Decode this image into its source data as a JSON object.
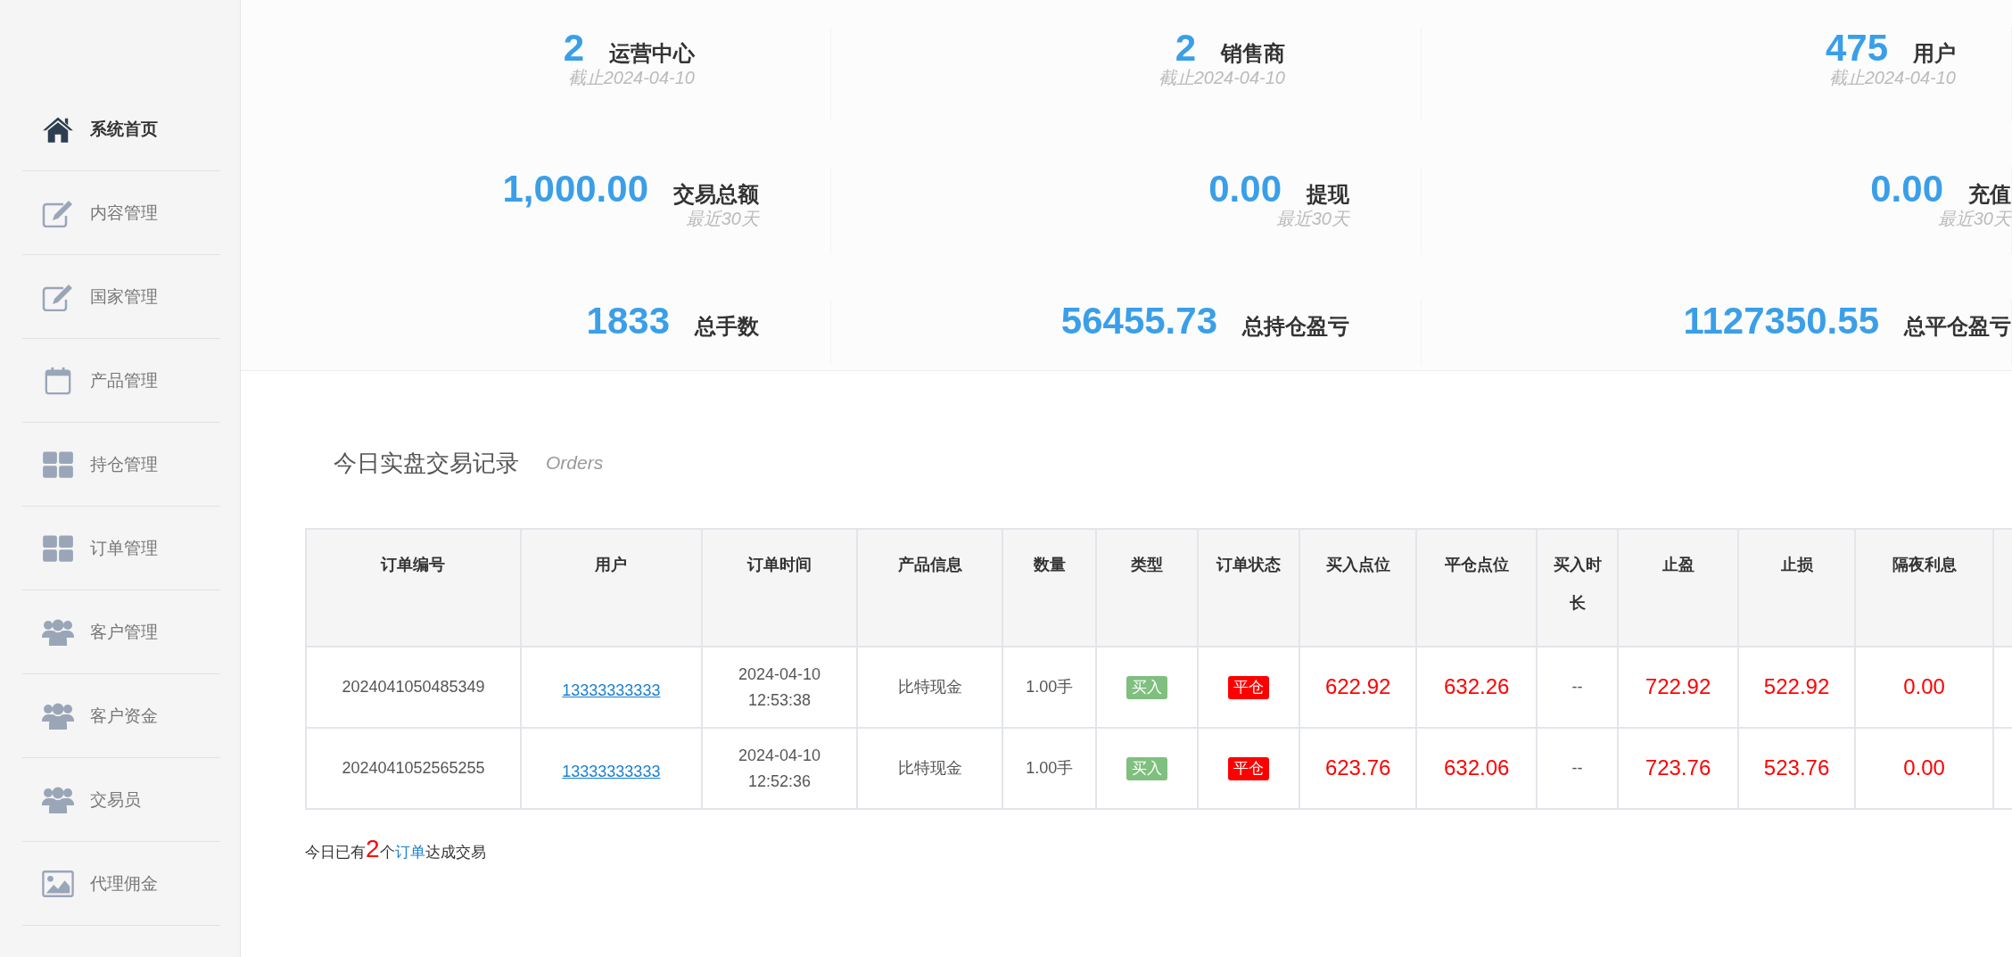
{
  "sidebar": {
    "items": [
      {
        "label": "系统首页",
        "kind": "home",
        "selected": true
      },
      {
        "label": "内容管理",
        "kind": "edit",
        "selected": false
      },
      {
        "label": "国家管理",
        "kind": "edit",
        "selected": false
      },
      {
        "label": "产品管理",
        "kind": "calendar",
        "selected": false
      },
      {
        "label": "持仓管理",
        "kind": "grid",
        "selected": false
      },
      {
        "label": "订单管理",
        "kind": "grid",
        "selected": false
      },
      {
        "label": "客户管理",
        "kind": "users",
        "selected": false
      },
      {
        "label": "客户资金",
        "kind": "users",
        "selected": false
      },
      {
        "label": "交易员",
        "kind": "users",
        "selected": false
      },
      {
        "label": "代理佣金",
        "kind": "image",
        "selected": false
      }
    ]
  },
  "stats": [
    [
      {
        "value": "2",
        "label": "运营中心",
        "note": "截止2024-04-10"
      },
      {
        "value": "2",
        "label": "销售商",
        "note": "截止2024-04-10"
      },
      {
        "value": "475",
        "label": "用户",
        "note": "截止2024-04-10"
      }
    ],
    [
      {
        "value": "1,000.00",
        "label": "交易总额",
        "note": "最近30天"
      },
      {
        "value": "0.00",
        "label": "提现",
        "note": "最近30天"
      },
      {
        "value": "0.00",
        "label": "充值",
        "note": "最近30天"
      }
    ],
    [
      {
        "value": "1833",
        "label": "总手数"
      },
      {
        "value": "56455.73",
        "label": "总持仓盈亏"
      },
      {
        "value": "1127350.55",
        "label": "总平仓盈亏"
      }
    ]
  ],
  "orders": {
    "title": "今日实盘交易记录",
    "subtitle": "Orders",
    "columns": [
      "订单编号",
      "用户",
      "订单时间",
      "产品信息",
      "数量",
      "类型",
      "订单状态",
      "买入点位",
      "平仓点位",
      "买入时长",
      "止盈",
      "止损",
      "隔夜利息"
    ],
    "rows": [
      {
        "order_no": "2024041050485349",
        "user": "13333333333",
        "time": "2024-04-10 12:53:38",
        "product": "比特现金",
        "quantity": "1.00手",
        "type": {
          "text": "买入",
          "kind": "buy"
        },
        "status": {
          "text": "平仓",
          "kind": "closed"
        },
        "open_price": "622.92",
        "close_price": "632.26",
        "duration": "--",
        "take_profit": "722.92",
        "stop_loss": "522.92",
        "overnight_interest": "0.00"
      },
      {
        "order_no": "2024041052565255",
        "user": "13333333333",
        "time": "2024-04-10 12:52:36",
        "product": "比特现金",
        "quantity": "1.00手",
        "type": {
          "text": "买入",
          "kind": "buy"
        },
        "status": {
          "text": "平仓",
          "kind": "closed"
        },
        "open_price": "623.76",
        "close_price": "632.06",
        "duration": "--",
        "take_profit": "723.76",
        "stop_loss": "523.76",
        "overnight_interest": "0.00"
      }
    ]
  },
  "summary": {
    "prefix": "今日已有",
    "count": "2",
    "middle": "个",
    "link": "订单",
    "suffix": "达成交易"
  }
}
